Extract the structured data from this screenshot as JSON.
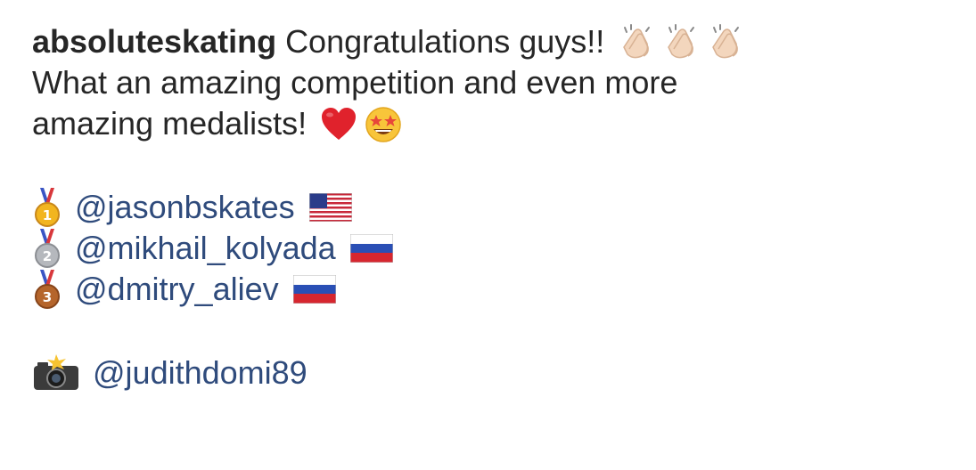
{
  "post": {
    "username": "absoluteskating",
    "line1_text": "Congratulations guys!!",
    "line2_text": "What an amazing competition and even more",
    "line3_text": "amazing medalists!",
    "line1_icons": [
      "clapping-hands-icon",
      "clapping-hands-icon",
      "clapping-hands-icon"
    ],
    "line3_icons": [
      "red-heart-icon",
      "star-struck-face-icon"
    ]
  },
  "medalists": [
    {
      "medal": "gold-medal-icon",
      "handle": "@jasonbskates",
      "flag": "usa-flag-icon"
    },
    {
      "medal": "silver-medal-icon",
      "handle": "@mikhail_kolyada",
      "flag": "russia-flag-icon"
    },
    {
      "medal": "bronze-medal-icon",
      "handle": "@dmitry_aliev",
      "flag": "russia-flag-icon"
    }
  ],
  "credit": {
    "icon": "camera-with-flash-icon",
    "handle": "@judithdomi89"
  }
}
